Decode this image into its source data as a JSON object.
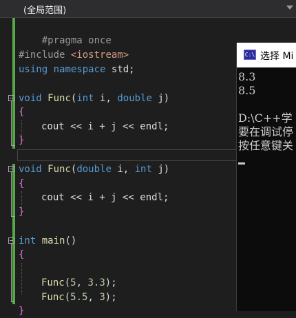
{
  "scope": {
    "label": "(全局范围)"
  },
  "code": {
    "l1_pp": "#pragma once",
    "l3_pp": "#include",
    "l3_hdr": "<iostream>",
    "l4_kw1": "using",
    "l4_kw2": "namespace",
    "l4_id": "std;",
    "f1_ret": "void",
    "f1_name": "Func",
    "f1_p1t": "int",
    "f1_p1n": "i,",
    "f1_p2t": "double",
    "f1_p2n": "j",
    "f1_body": "cout << i + j << endl;",
    "f2_ret": "void",
    "f2_name": "Func",
    "f2_p1t": "double",
    "f2_p1n": "i,",
    "f2_p2t": "int",
    "f2_p2n": "j",
    "f2_body": "cout << i + j << endl;",
    "m_ret": "int",
    "m_name": "main",
    "m_call1_fn": "Func",
    "m_call1_a1": "5",
    "m_call1_a2": "3.3",
    "m_call2_fn": "Func",
    "m_call2_a1": "5.5",
    "m_call2_a2": "3",
    "open_brace": "{",
    "close_brace": "}",
    "lparen": "(",
    "rparen": ")",
    "comma": ",",
    "semi": ";"
  },
  "console": {
    "title": "选择 Mi",
    "icon_text": "C:\\",
    "lines": [
      "8.3",
      "8.5",
      "",
      "D:\\C++学",
      "要在调试停",
      "按任意键关"
    ]
  },
  "colors": {
    "keyword": "#569cd6",
    "function": "#dcdcaa",
    "number": "#b5cea8",
    "preproc": "#9b9b9b",
    "change_bar": "#57a64a"
  }
}
